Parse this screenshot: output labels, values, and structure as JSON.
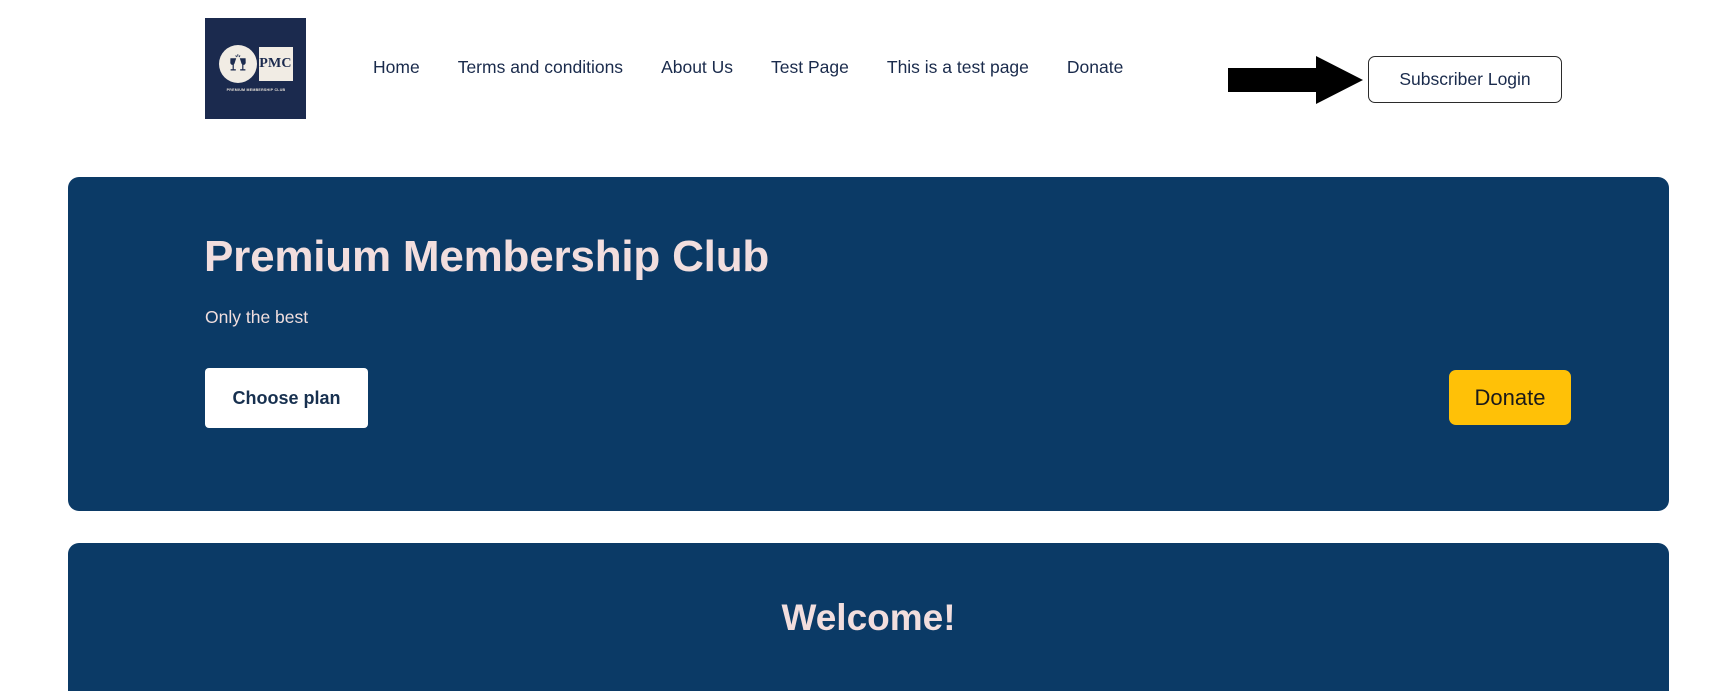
{
  "header": {
    "logo": {
      "name": "pmc-logo",
      "monogram": "PMC",
      "tagline": "PREMIUM MEMBERSHIP CLUB",
      "glasses_icon": "wine-glasses-icon",
      "background_color": "#1b2a4e",
      "mark_color": "#f1ece4"
    },
    "nav": {
      "items": [
        {
          "label": "Home"
        },
        {
          "label": "Terms and conditions"
        },
        {
          "label": "About Us"
        },
        {
          "label": "Test Page"
        },
        {
          "label": "This is a test page"
        },
        {
          "label": "Donate"
        }
      ]
    },
    "annotation": {
      "icon": "right-arrow-icon",
      "color": "#000000"
    },
    "login_button": {
      "label": "Subscriber Login",
      "text_color": "#1a2b4c",
      "border_color": "#2b2b2b"
    }
  },
  "hero": {
    "title": "Premium Membership Club",
    "subtitle": "Only the best",
    "background_color": "#0b3a66",
    "title_color": "#f2dede",
    "choose_plan_button": {
      "label": "Choose plan",
      "background_color": "#ffffff",
      "text_color": "#17304f"
    },
    "donate_button": {
      "label": "Donate",
      "background_color": "#ffc107",
      "text_color": "#1a1a1a"
    }
  },
  "welcome": {
    "title": "Welcome!",
    "background_color": "#0b3a66",
    "title_color": "#f2dede"
  }
}
